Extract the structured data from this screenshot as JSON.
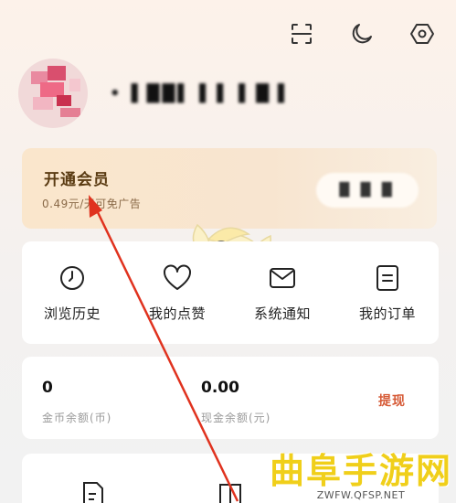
{
  "header": {
    "icons": [
      "scan-icon",
      "moon-icon",
      "settings-icon"
    ]
  },
  "profile": {
    "username": "• ▌██▌▐ ▌▐ █▐"
  },
  "vip": {
    "title": "开通会员",
    "subtitle": "0.49元/天可免广告",
    "button_label": "█ █ █"
  },
  "menu": {
    "items": [
      {
        "label": "浏览历史",
        "icon": "clock-icon"
      },
      {
        "label": "我的点赞",
        "icon": "heart-icon"
      },
      {
        "label": "系统通知",
        "icon": "mail-icon"
      },
      {
        "label": "我的订单",
        "icon": "order-icon"
      }
    ]
  },
  "wallet": {
    "coins_value": "0",
    "coins_label": "金币余额(币)",
    "cash_value": "0.00",
    "cash_label": "现金余额(元)",
    "withdraw_label": "提现"
  },
  "watermark": {
    "main": "曲阜手游网",
    "sub": "ZWFW.QFSP.NET"
  },
  "colors": {
    "accent": "#d65a36",
    "vip_text": "#5a3b12",
    "annotation_arrow": "#e0321e",
    "watermark": "#f0cf1a"
  }
}
